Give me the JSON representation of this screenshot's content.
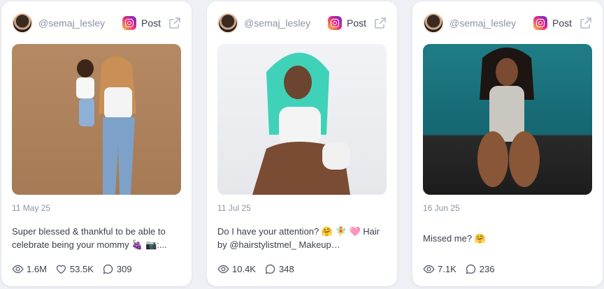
{
  "posts": [
    {
      "handle": "@semaj_lesley",
      "platform_label": "Post",
      "date": "11 May 25",
      "caption": "Super blessed & thankful to be able to celebrate being your mommy 🍇 📷:...",
      "views": "1.6M",
      "likes": "53.5K",
      "comments": "309"
    },
    {
      "handle": "@semaj_lesley",
      "platform_label": "Post",
      "date": "11 Jul 25",
      "caption": "Do I have your attention? 🤗 🧚 🩷 Hair by @hairstylistmel_ Makeup @themajaffec...",
      "views": "10.4K",
      "comments": "348"
    },
    {
      "handle": "@semaj_lesley",
      "platform_label": "Post",
      "date": "16 Jun 25",
      "caption": "Missed me? 🤗",
      "views": "7.1K",
      "comments": "236"
    }
  ],
  "icons": {
    "platform": "instagram-icon",
    "external": "external-link-icon",
    "views": "eye-icon",
    "likes": "heart-icon",
    "comments": "comment-icon"
  },
  "colors": {
    "background": "#eef0f5",
    "card": "#ffffff",
    "muted_text": "#8b93a3"
  }
}
